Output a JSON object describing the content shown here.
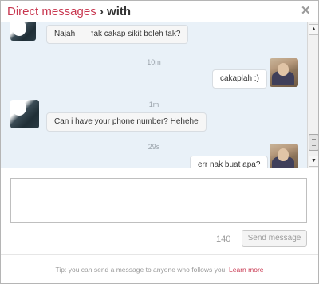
{
  "header": {
    "title_accent": "Direct messages",
    "title_rest": " › with",
    "close_label": "✕"
  },
  "thread": {
    "messages": [
      {
        "side": "left",
        "text": "Najah. ` `  nak cakap sikit boleh tak?"
      },
      {
        "side": "right",
        "timestamp": "10m",
        "text": "cakaplah :)"
      },
      {
        "side": "left",
        "timestamp": "1m",
        "text": "Can i have your phone number? Hehehe"
      },
      {
        "side": "right",
        "timestamp": "29s",
        "text": "err nak buat apa?"
      }
    ]
  },
  "scrollbar": {
    "up_glyph": "▲",
    "down_glyph": "▼"
  },
  "compose": {
    "value": "",
    "char_count": "140",
    "send_label": "Send message"
  },
  "footer": {
    "tip_text": "Tip: you can send a message to anyone who follows you.",
    "link_text": "Learn more"
  },
  "colors": {
    "accent": "#c8364f",
    "thread_background": "#e9f1f8"
  }
}
